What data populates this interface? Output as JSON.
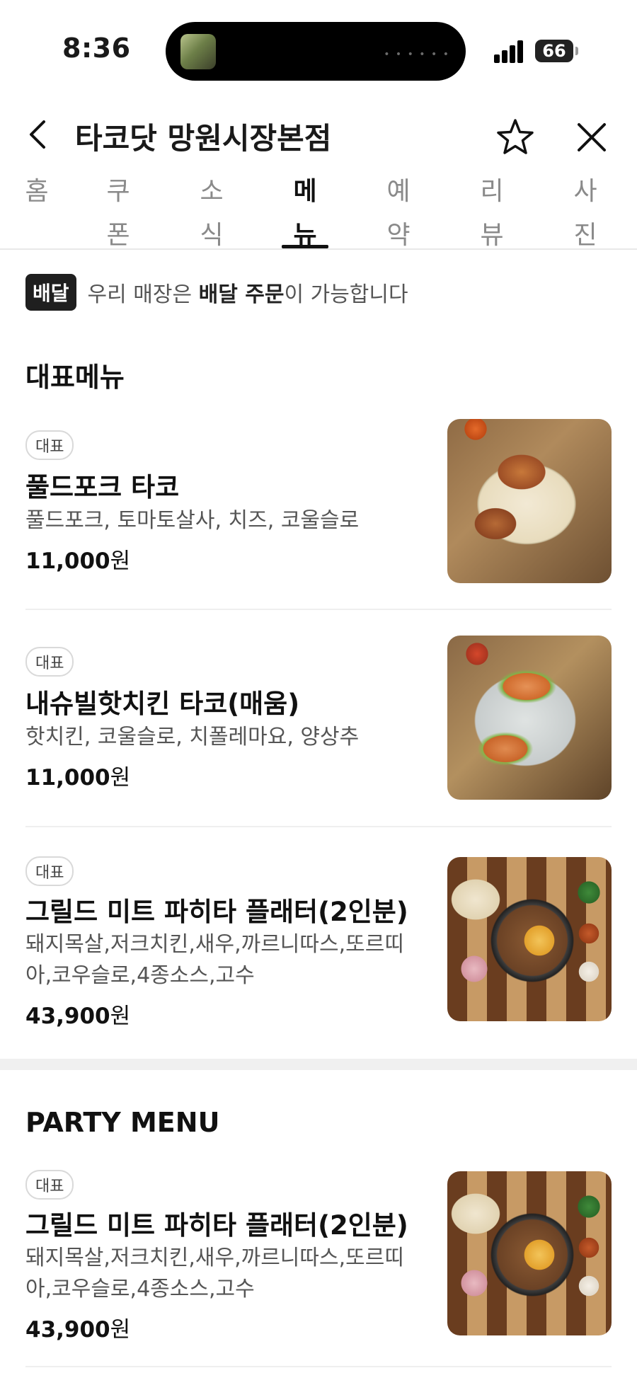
{
  "status_bar": {
    "time": "8:36",
    "battery": "66"
  },
  "header": {
    "title": "타코닷 망원시장본점"
  },
  "tabs": [
    {
      "label": "홈"
    },
    {
      "label": "쿠폰"
    },
    {
      "label": "소식"
    },
    {
      "label": "메뉴"
    },
    {
      "label": "예약"
    },
    {
      "label": "리뷰"
    },
    {
      "label": "사진"
    }
  ],
  "active_tab": "메뉴",
  "delivery_notice": {
    "badge": "배달",
    "text_before": "우리 매장은 ",
    "text_bold": "배달 주문",
    "text_after": "이 가능합니다"
  },
  "sections": [
    {
      "title": "대표메뉴",
      "items": [
        {
          "tag": "대표",
          "name": "풀드포크 타코",
          "description": "풀드포크, 토마토살사, 치즈, 코울슬로",
          "price": "11,000",
          "currency": "원",
          "image_icon": "taco-plate-photo"
        },
        {
          "tag": "대표",
          "name": "내슈빌핫치킨 타코(매움)",
          "description": "핫치킨, 코울슬로, 치폴레마요, 양상추",
          "price": "11,000",
          "currency": "원",
          "image_icon": "chicken-taco-photo"
        },
        {
          "tag": "대표",
          "name": "그릴드 미트 파히타 플래터(2인분)",
          "description": "돼지목살,저크치킨,새우,까르니따스,또르띠아,코우슬로,4종소스,고수",
          "price": "43,900",
          "currency": "원",
          "image_icon": "fajita-platter-photo"
        }
      ]
    },
    {
      "title": "PARTY MENU",
      "items": [
        {
          "tag": "대표",
          "name": "그릴드 미트 파히타 플래터(2인분)",
          "description": "돼지목살,저크치킨,새우,까르니따스,또르띠아,코우슬로,4종소스,고수",
          "price": "43,900",
          "currency": "원",
          "image_icon": "fajita-platter-photo"
        }
      ]
    }
  ],
  "colors": {
    "text": "#111111",
    "muted": "#8a8a8a",
    "badge_dark": "#1f1f1f",
    "divider": "#efefef"
  }
}
